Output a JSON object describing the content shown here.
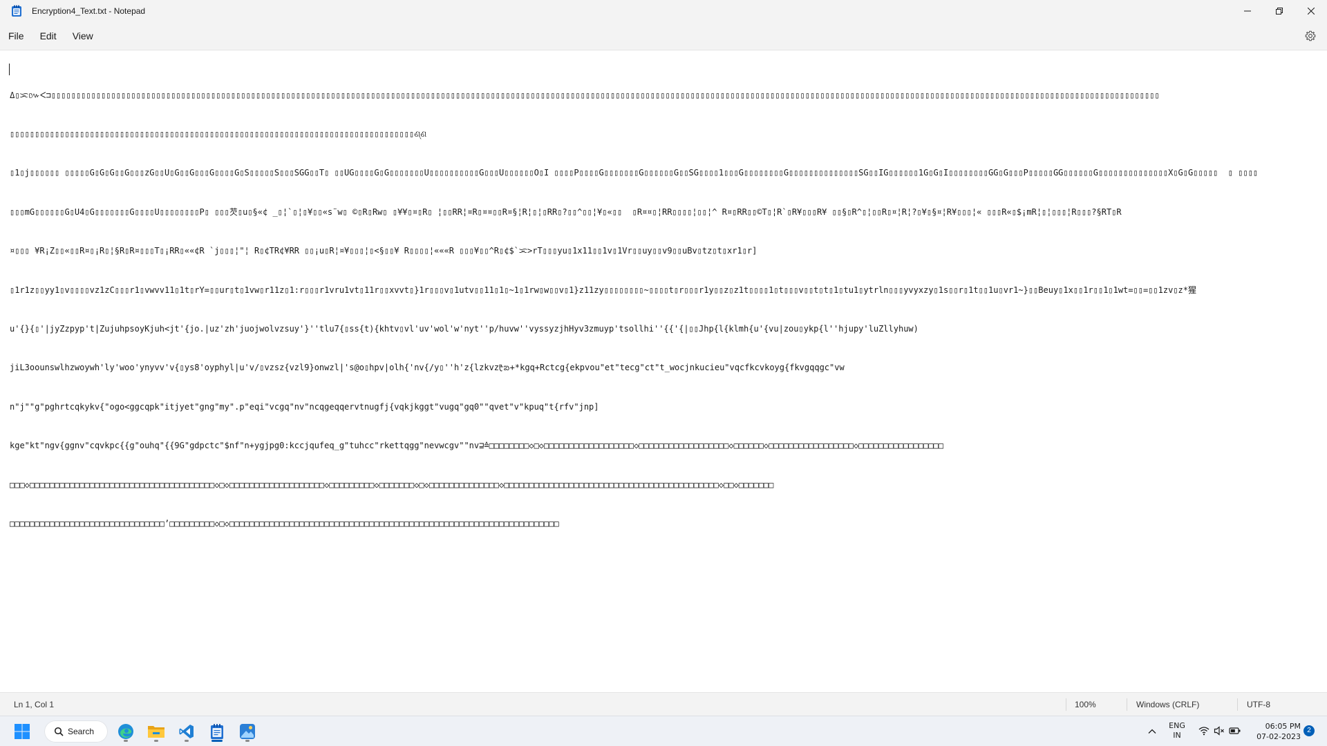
{
  "window": {
    "title": "Encryption4_Text.txt - Notepad",
    "icon": "notepad-icon",
    "controls": [
      "minimize-icon",
      "restore-icon",
      "close-icon"
    ]
  },
  "menubar": {
    "items": [
      {
        "label": "File"
      },
      {
        "label": "Edit"
      },
      {
        "label": "View"
      }
    ],
    "settings_icon": "gear-icon"
  },
  "editor": {
    "lines": [
      "ߡ▯ᜁ៚ᐸ⊐▯▯▯▯▯▯▯▯▯▯▯▯▯▯▯▯▯▯▯▯▯▯▯▯▯▯▯▯▯▯▯▯▯▯▯▯▯▯▯▯▯▯▯▯▯▯▯▯▯▯▯▯▯▯▯▯▯▯▯▯▯▯▯▯▯▯▯▯▯▯▯▯▯▯▯▯▯▯▯▯▯▯▯▯▯▯▯▯▯▯▯▯▯▯▯▯▯▯▯▯▯▯▯▯▯▯▯▯▯▯▯▯▯▯▯▯▯▯▯▯▯▯▯▯▯▯▯▯▯▯▯▯▯▯▯▯▯▯▯▯▯▯▯▯▯▯▯▯▯▯▯▯▯▯▯▯▯▯▯▯▯▯▯▯▯▯▯▯▯▯▯▯▯▯▯▯▯▯▯▯▯▯▯▯▯▯▯▯▯▯▯▯▯▯▯▯▯▯▯▯▯▯▯▯▯▯▯▯▯▯▯▯▯▯▯▯▯▯▯▯▯▯",
      "▯▯▯▯▯▯▯▯▯▯▯▯▯▯▯▯▯▯▯▯▯▯▯▯▯▯▯▯▯▯▯▯▯▯▯▯▯▯▯▯▯▯▯▯▯▯▯▯▯▯▯▯▯▯▯▯▯▯▯▯▯▯▯▯▯▯▯▯▯▯▯▯▯▯▯▯▯▯▯▯▯ଣ୍ଣ",
      "▯1▯j▯▯▯▯▯▯ ▯▯▯▯▯G▯G▯G▯▯G▯▯▯zG▯▯U▯G▯▯G▯▯▯G▯▯▯▯G▯S▯▯▯▯▯S▯▯▯SGG▯▯T▯ ▯▯UG▯▯▯▯G▯G▯▯▯▯▯▯▯U▯▯▯▯▯▯▯▯▯▯G▯▯▯U▯▯▯▯▯▯O▯I ▯▯▯▯P▯▯▯▯G▯▯▯▯▯▯▯G▯▯▯▯▯▯G▯▯SG▯▯▯▯1▯▯▯G▯▯▯▯▯▯▯▯G▯▯▯▯▯▯▯▯▯▯▯▯▯▯SG▯▯IG▯▯▯▯▯▯1G▯G▯I▯▯▯▯▯▯▯▯GG▯G▯▯▯P▯▯▯▯▯GG▯▯▯▯▯▯G▯▯▯▯▯▯▯▯▯▯▯▯▯▯X▯G▯G▯▯▯▯▯  ▯ ▯▯▯▯",
      "▯▯▯mG▯▯▯▯▯▯G▯U4▯G▯▯▯▯▯▯▯G▯▯▯▯U▯▯▯▯▯▯▯▯P▯ ▯▯▯芡▯u▯§«¢ _▯¦`▯¦▯¥▯▯«s¨w▯ ©▯R▯Rw▯ ▯¥¥▯¤▯R▯ ¦▯▯RR¦¤R▯¤¤▯▯R¤§¦R¦▯¦▯RR▯?▯▯^▯▯¦¥▯«▯▯  ▯R¤¤▯¦RR▯▯▯▯¦▯▯¦^ R¤▯RR▯▯©T▯¦R`▯R¥▯▯▯R¥ ▯▯§▯R^▯¦▯▯R▯¤¦R¦?▯¥▯§¤¦R¥▯▯▯¦« ▯▯▯R«▯$¡mR¦▯¦▯▯▯¦R▯▯▯?§RT▯R",
      "¤▯▯▯ ¥R¡Z▯▯«▯▯R¤▯¡R▯¦§R▯R¤▯▯▯T▯¡RR▯««¢R `j▯▯▯¦\"¦ R▯¢TR¢¥RR ▯▯¡u▯R¦¤¥▯▯▯¦▯<§▯▯¥ R▯▯▯▯¦«««R ▯▯▯¥▯▯^R▯¢$`ᜁ>rT▯▯▯yu▯1x11▯▯1v▯1Vr▯▯uy▯▯v9▯▯uBv▯tz▯t▯xr1▯r]",
      "▯1r1z▯▯yy1▯v▯▯▯▯vz1zC▯▯▯r1▯vwvv11▯1t▯rY=▯▯ur▯t▯1vw▯r11z▯1:r▯▯▯r1vru1vt▯11r▯▯xvvt▯}1r▯▯▯v▯1utv▯▯11▯1▯~1▯1rw▯w▯▯v▯1}z11zy▯▯▯▯▯▯▯▯~▯▯▯▯t▯r▯▯▯r1y▯▯z▯z1t▯▯▯▯1▯t▯▯▯v▯▯t▯t▯1▯tu1▯ytrln▯▯▯yvyxzy▯1s▯▯r▯1t▯▯1u▯vr1~}▯▯Beuy▯1x▯▯1r▯▯1▯1wt=▯▯=▯▯1zv▯z*猩",
      "u'{}{▯'|jyZzpyp't|ZujuhpsoyKjuh<jt'{jo.|uz'zh'juojwolvzsuy'}''tlu7{▯ss{t){khtv▯vl'uv'wol'w'nyt''p/huvw''vyssyzjhHyv3zmuyp'tsollhi''{{'{|▯▯Jhp{l{klmh{u'{vu|zou▯ykp{l''hjupy'luZllyhuw)",
      "jiL3oounswlhzwoywh'ly'woo'ynyvv'v{▯ys8'oyphyl|u'v/▯vzsz{vzl9}onwzl|'s@o▯hpv|olh{'nv{/y▯''h'z{lzkvzᡛᨰ+*kgq+Rctcg{ekpvou\"et\"tecg\"ct\"t_wocjnkucieu\"vqcfkcvkoyg{fkvgqqgc\"vw",
      "n\"j\"\"g\"pghrtcqkykv{\"ogo<ggcqpk\"itjyet\"gng\"my\".p\"eqi\"vcgq\"nv\"ncqgeqqervtnugfj{vqkjkggt\"vugq\"gq0\"\"qvet\"v\"kpuq\"t{rfv\"jnp]",
      "kge\"kt\"ngv{ggnv\"cqvkpc{{g\"ouhq\"{{9G\"gdpctc\"$nf\"n+ygjpg0:kccjqufeq_g\"tuhcc\"rkettqgg\"nevwcgv\"\"nv⊒≙□□□□□□□□◇□◇□□□□□□□□□□□□□□□□□□◇□□□□□□□□□□□□□□□□□□◇□□□□□□◇□□□□□□□□□□□□□□□□□◇□□□□□□□□□□□□□□□□□",
      "□□□◇□□□□□□□□□□□□□□□□□□□□□□□□□□□□□□□□□□□□□◇□◇□□□□□□□□□□□□□□□□□□□◇□□□□□□□□□◇□□□□□□□◇□◇□□□□□□□□□□□□□□◇□□□□□□□□□□□□□□□□□□□□□□□□□□□□□□□□□□□□□□□□□□□◇□□◇□□□□□□□",
      "□□□□□□□□□□□□□□□□□□□□□□□□□□□□□□□’□□□□□□□□□◇□◇□□□□□□□□□□□□□□□□□□□□□□□□□□□□□□□□□□□□□□□□□□□□□□□□□□□□□□□□□□□□□□□□□□"
    ]
  },
  "statusbar": {
    "position": "Ln 1, Col 1",
    "zoom": "100%",
    "line_ending": "Windows (CRLF)",
    "encoding": "UTF-8"
  },
  "taskbar": {
    "start_icon": "windows-start-icon",
    "search_label": "Search",
    "apps": [
      {
        "name": "edge-icon",
        "active": false
      },
      {
        "name": "file-explorer-icon",
        "active": false
      },
      {
        "name": "vscode-icon",
        "active": false
      },
      {
        "name": "notepad-icon",
        "active": true
      },
      {
        "name": "photos-icon",
        "active": false
      }
    ],
    "tray": {
      "lang_line1": "ENG",
      "lang_line2": "IN",
      "time": "06:05 PM",
      "date": "07-02-2023",
      "notification_count": "2",
      "icons": [
        "chevron-up-icon",
        "wifi-icon",
        "speaker-muted-icon",
        "battery-icon"
      ]
    }
  },
  "colors": {
    "chrome_bg": "#f3f3f3",
    "editor_bg": "#ffffff",
    "taskbar_bg": "#eef1f6",
    "accent": "#005fb8"
  }
}
